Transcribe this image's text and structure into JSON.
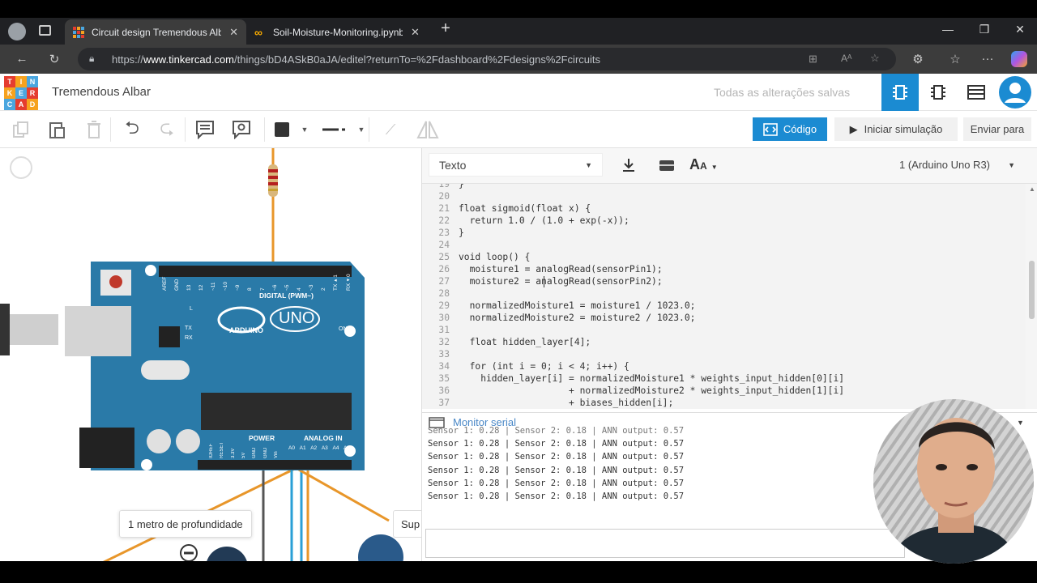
{
  "browser": {
    "tabs": [
      {
        "title": "Circuit design Tremendous Albar",
        "active": true
      },
      {
        "title": "Soil-Moisture-Monitoring.ipynb",
        "active": false
      }
    ],
    "url_prefix": "https://",
    "url_domain": "www.tinkercad.com",
    "url_path": "/things/bD4ASkB0aJA/editel?returnTo=%2Fdashboard%2Fdesigns%2Fcircuits"
  },
  "tinkercad": {
    "logo_letters": [
      "T",
      "I",
      "N",
      "K",
      "E",
      "R",
      "C",
      "A",
      "D"
    ],
    "logo_colors": [
      "#e53c2f",
      "#f6a21e",
      "#4aa6df",
      "#f6a21e",
      "#4aa6df",
      "#e53c2f",
      "#4aa6df",
      "#e53c2f",
      "#f6a21e"
    ],
    "design_name": "Tremendous Albar",
    "save_status": "Todas as alterações salvas",
    "accent": "#1b8bd2"
  },
  "toolbar": {
    "code_label": "Código",
    "simulate_label": "Iniciar simulação",
    "send_label": "Enviar para"
  },
  "editor": {
    "mode": "Texto",
    "board": "1 (Arduino Uno R3)",
    "lines": [
      {
        "n": "19",
        "t": "}"
      },
      {
        "n": "20",
        "t": ""
      },
      {
        "n": "21",
        "t": "float sigmoid(float x) {"
      },
      {
        "n": "22",
        "t": "  return 1.0 / (1.0 + exp(-x));"
      },
      {
        "n": "23",
        "t": "}"
      },
      {
        "n": "24",
        "t": ""
      },
      {
        "n": "25",
        "t": "void loop() {"
      },
      {
        "n": "26",
        "t": "  moisture1 = analogRead(sensorPin1);"
      },
      {
        "n": "27",
        "t": "  moisture2 = analogRead(sensorPin2);"
      },
      {
        "n": "28",
        "t": ""
      },
      {
        "n": "29",
        "t": "  normalizedMoisture1 = moisture1 / 1023.0;"
      },
      {
        "n": "30",
        "t": "  normalizedMoisture2 = moisture2 / 1023.0;"
      },
      {
        "n": "31",
        "t": ""
      },
      {
        "n": "32",
        "t": "  float hidden_layer[4];"
      },
      {
        "n": "33",
        "t": ""
      },
      {
        "n": "34",
        "t": "  for (int i = 0; i < 4; i++) {"
      },
      {
        "n": "35",
        "t": "    hidden_layer[i] = normalizedMoisture1 * weights_input_hidden[0][i]"
      },
      {
        "n": "36",
        "t": "                    + normalizedMoisture2 * weights_input_hidden[1][i]"
      },
      {
        "n": "37",
        "t": "                    + biases_hidden[i];"
      }
    ]
  },
  "serial": {
    "title": "Monitor serial",
    "lines": [
      "Sensor 1: 0.28 | Sensor 2: 0.18 | ANN output: 0.57",
      "Sensor 1: 0.28 | Sensor 2: 0.18 | ANN output: 0.57",
      "Sensor 1: 0.28 | Sensor 2: 0.18 | ANN output: 0.57",
      "Sensor 1: 0.28 | Sensor 2: 0.18 | ANN output: 0.57",
      "Sensor 1: 0.28 | Sensor 2: 0.18 | ANN output: 0.57",
      "Sensor 1: 0.28 | Sensor 2: 0.18 | ANN output: 0.57"
    ]
  },
  "canvas": {
    "label1": "1 metro de profundidade",
    "label2": "Sup",
    "board_brand": "ARDUINO",
    "board_model": "UNO",
    "digital_label": "DIGITAL (PWM~)",
    "power_label": "POWER",
    "analog_label": "ANALOG IN",
    "on_label": "ON",
    "pins_digital": [
      "AREF",
      "GND",
      "13",
      "12",
      "~11",
      "~10",
      "~9",
      "8",
      "7",
      "~6",
      "~5",
      "4",
      "~3",
      "2",
      "TX▸1",
      "RX◂0"
    ],
    "pins_power": [
      "IOREF",
      "RESET",
      "3.3V",
      "5V",
      "GND",
      "GND",
      "Vin"
    ],
    "pins_analog": [
      "A0",
      "A1",
      "A2",
      "A3",
      "A4",
      "A5"
    ],
    "led_labels": [
      "L",
      "TX",
      "RX"
    ]
  }
}
